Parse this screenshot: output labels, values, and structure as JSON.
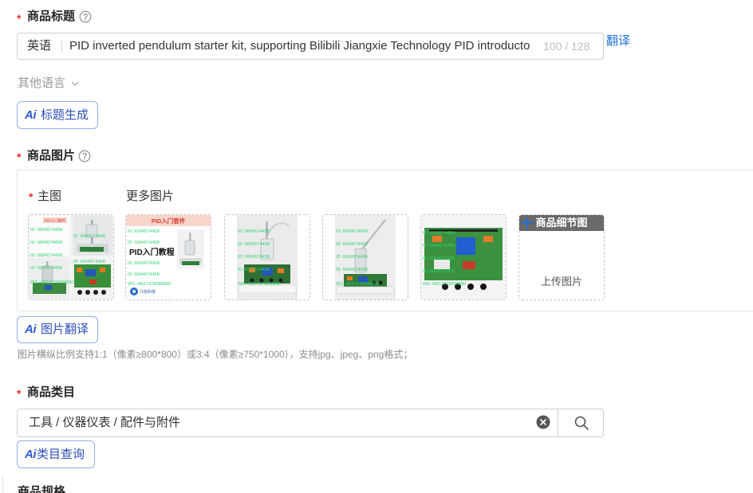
{
  "required_mark": "*",
  "colors": {
    "required": "#e5332a",
    "link": "#1f6fd6",
    "ai_accent": "#2f5bd0",
    "border": "#cfcfcf",
    "muted_text": "#9a9a9a",
    "watermark": "#2fd36a",
    "detail_header": "#6a6a6a"
  },
  "icons": {
    "help": "question-circle-icon",
    "expand": "chevron-down-icon",
    "ai": "ai-icon",
    "add": "plus-icon",
    "clear": "close-circle-icon",
    "search": "search-icon"
  },
  "title_field": {
    "label": "商品标题",
    "language": "英语",
    "value": "PID inverted pendulum starter kit, supporting Bilibili Jiangxie Technology PID introducto",
    "counter": "100 / 128",
    "translate_link": "翻译"
  },
  "other_languages": {
    "label": "其他语言"
  },
  "title_ai_button": {
    "icon_text": "Ai",
    "label": "标题生成"
  },
  "images_field": {
    "label": "商品图片",
    "main_label": "主图",
    "more_label": "更多图片",
    "photo_text": {
      "watermark_id": "ID: 6004574458",
      "watermark_contact": "WS +8617378288890",
      "kit_title": "PID入门套件",
      "tutorial_title": "PID入门教程",
      "brand": "江协科技"
    },
    "detail_slot": {
      "header": "商品细节图",
      "upload_label": "上传图片"
    }
  },
  "image_ai_button": {
    "icon_text": "Ai",
    "label": "图片翻译"
  },
  "image_hint": "图片横纵比例支持1:1（像素≥800*800）或3:4（像素≥750*1000），支持jpg、jpeg、png格式；",
  "category_field": {
    "label": "商品类目",
    "value": "工具 / 仪器仪表 / 配件与附件"
  },
  "category_ai_button": {
    "icon_text": "Ai",
    "label": "类目查询"
  },
  "next_section": {
    "label": "商品规格"
  }
}
